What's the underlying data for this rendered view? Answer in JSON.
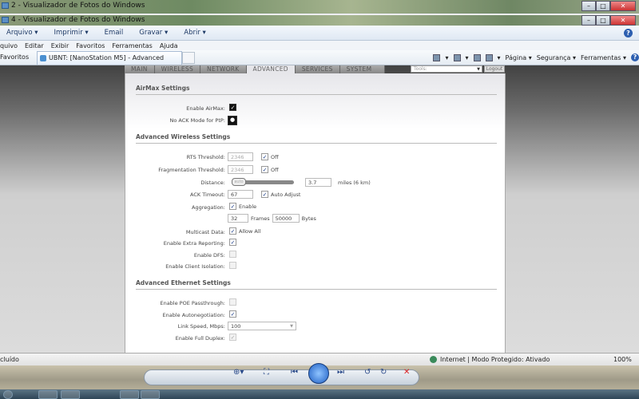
{
  "windows": [
    {
      "title": "2 - Visualizador de Fotos do Windows"
    },
    {
      "title": "4 - Visualizador de Fotos do Windows"
    }
  ],
  "viewer_menu": [
    "Arquivo ▾",
    "Imprimir ▾",
    "Email",
    "Gravar ▾",
    "Abrir ▾"
  ],
  "ie_menu": [
    "quivo",
    "Editar",
    "Exibir",
    "Favoritos",
    "Ferramentas",
    "Ajuda"
  ],
  "favorites_label": "Favoritos",
  "tab_title": "UBNT: [NanoStation M5] - Advanced",
  "ie_tools": [
    "Página ▾",
    "Segurança ▾",
    "Ferramentas ▾"
  ],
  "nav_tabs": [
    "MAIN",
    "WIRELESS",
    "NETWORK",
    "ADVANCED",
    "SERVICES",
    "SYSTEM"
  ],
  "active_tab": "ADVANCED",
  "tools_select": "Tools:",
  "logout": "Logout",
  "airmax": {
    "heading": "AirMax Settings",
    "enable_label": "Enable AirMax:",
    "noack_label": "No ACK Mode for PtP:"
  },
  "wireless": {
    "heading": "Advanced Wireless Settings",
    "rts_label": "RTS Threshold:",
    "rts_value": "2346",
    "rts_off": "Off",
    "frag_label": "Fragmentation Threshold:",
    "frag_value": "2346",
    "frag_off": "Off",
    "distance_label": "Distance:",
    "distance_slider_text": "auto",
    "distance_value": "3.7",
    "distance_unit": "miles (6 km)",
    "ack_label": "ACK Timeout:",
    "ack_value": "67",
    "ack_auto": "Auto Adjust",
    "agg_label": "Aggregation:",
    "agg_enable": "Enable",
    "frames_value": "32",
    "frames_label": "Frames",
    "bytes_value": "50000",
    "bytes_label": "Bytes",
    "multicast_label": "Multicast Data:",
    "multicast_allow": "Allow All",
    "extra_label": "Enable Extra Reporting:",
    "dfs_label": "Enable DFS:",
    "isolation_label": "Enable Client Isolation:"
  },
  "ethernet": {
    "heading": "Advanced Ethernet Settings",
    "poe_label": "Enable POE Passthrough:",
    "autoneg_label": "Enable Autonegotiation:",
    "speed_label": "Link Speed, Mbps:",
    "speed_value": "100",
    "duplex_label": "Enable Full Duplex:"
  },
  "status": {
    "left": "cluído",
    "zone": "Internet | Modo Protegido: Ativado",
    "zoom": "100%"
  }
}
